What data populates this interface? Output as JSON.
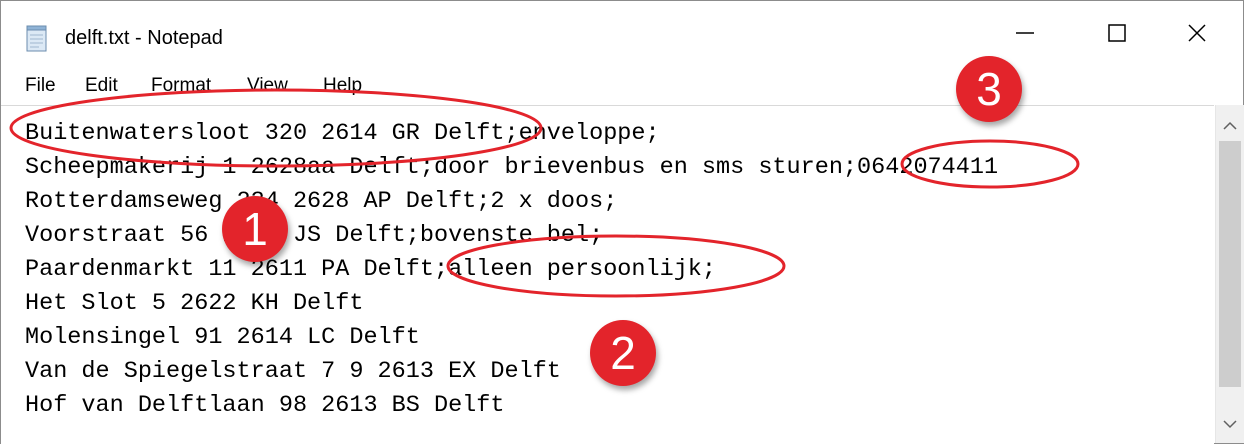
{
  "window": {
    "title": "delft.txt - Notepad",
    "controls": {
      "minimize_icon": "minimize-icon",
      "maximize_icon": "maximize-icon",
      "close_icon": "close-icon"
    }
  },
  "menu": [
    "File",
    "Edit",
    "Format",
    "View",
    "Help"
  ],
  "editor": {
    "lines": [
      "Buitenwatersloot 320 2614 GR Delft;enveloppe;",
      "Scheepmakerij 1 2628aa Delft;door brievenbus en sms sturen;0642074411",
      "Rotterdamseweg 234 2628 AP Delft;2 x doos;",
      "Voorstraat 56 2611 JS Delft;bovenste bel;",
      "Paardenmarkt 11 2611 PA Delft;alleen persoonlijk;",
      "Het Slot 5 2622 KH Delft",
      "Molensingel 91 2614 LC Delft",
      "Van de Spiegelstraat 7 9 2613 EX Delft",
      "Hof van Delftlaan 98 2613 BS Delft"
    ]
  },
  "annotations": {
    "badges": [
      "1",
      "2",
      "3"
    ],
    "color": "#e3242b"
  }
}
